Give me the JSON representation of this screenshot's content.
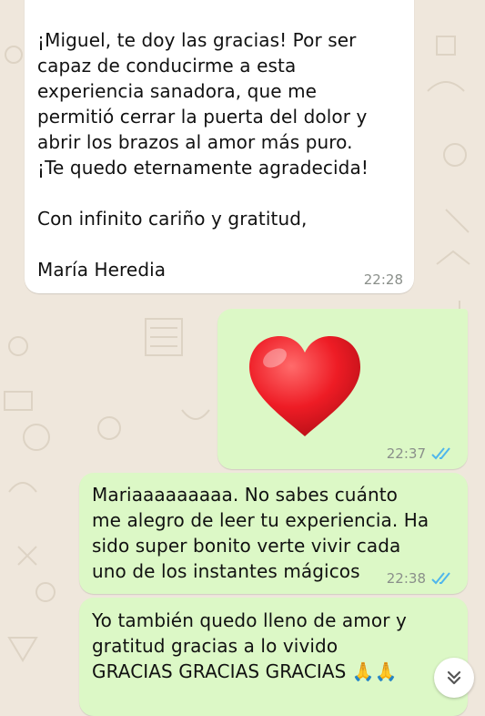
{
  "colors": {
    "incoming_bubble": "#ffffff",
    "outgoing_bubble": "#dcf8c6",
    "wallpaper": "#efe7dc",
    "read_ticks": "#4fb6ec",
    "timestamp": "#8a8f8a"
  },
  "messages": [
    {
      "direction": "incoming",
      "text": "¡Miguel, te doy las gracias! Por ser\ncapaz de conducirme a esta\nexperiencia sanadora, que me\npermitió cerrar la puerta del dolor y\nabrir los brazos al amor más puro.\n¡Te quedo eternamente agradecida!\n\nCon infinito cariño y gratitud,\n\nMaría Heredia",
      "time": "22:28"
    },
    {
      "direction": "outgoing",
      "emoji": "heart",
      "time": "22:37",
      "status": "read"
    },
    {
      "direction": "outgoing",
      "text": "Mariaaaaaaaaa. No sabes cuánto\nme alegro de leer tu experiencia. Ha\nsido super bonito verte vivir cada\nuno de los instantes mágicos",
      "time": "22:38",
      "status": "read"
    },
    {
      "direction": "outgoing",
      "text": "Yo también quedo lleno de amor y\ngratitud gracias a lo vivido\nGRACIAS GRACIAS GRACIAS 🙏🙏"
    }
  ],
  "scroll_button": {
    "icon": "double-chevron-down-icon"
  }
}
